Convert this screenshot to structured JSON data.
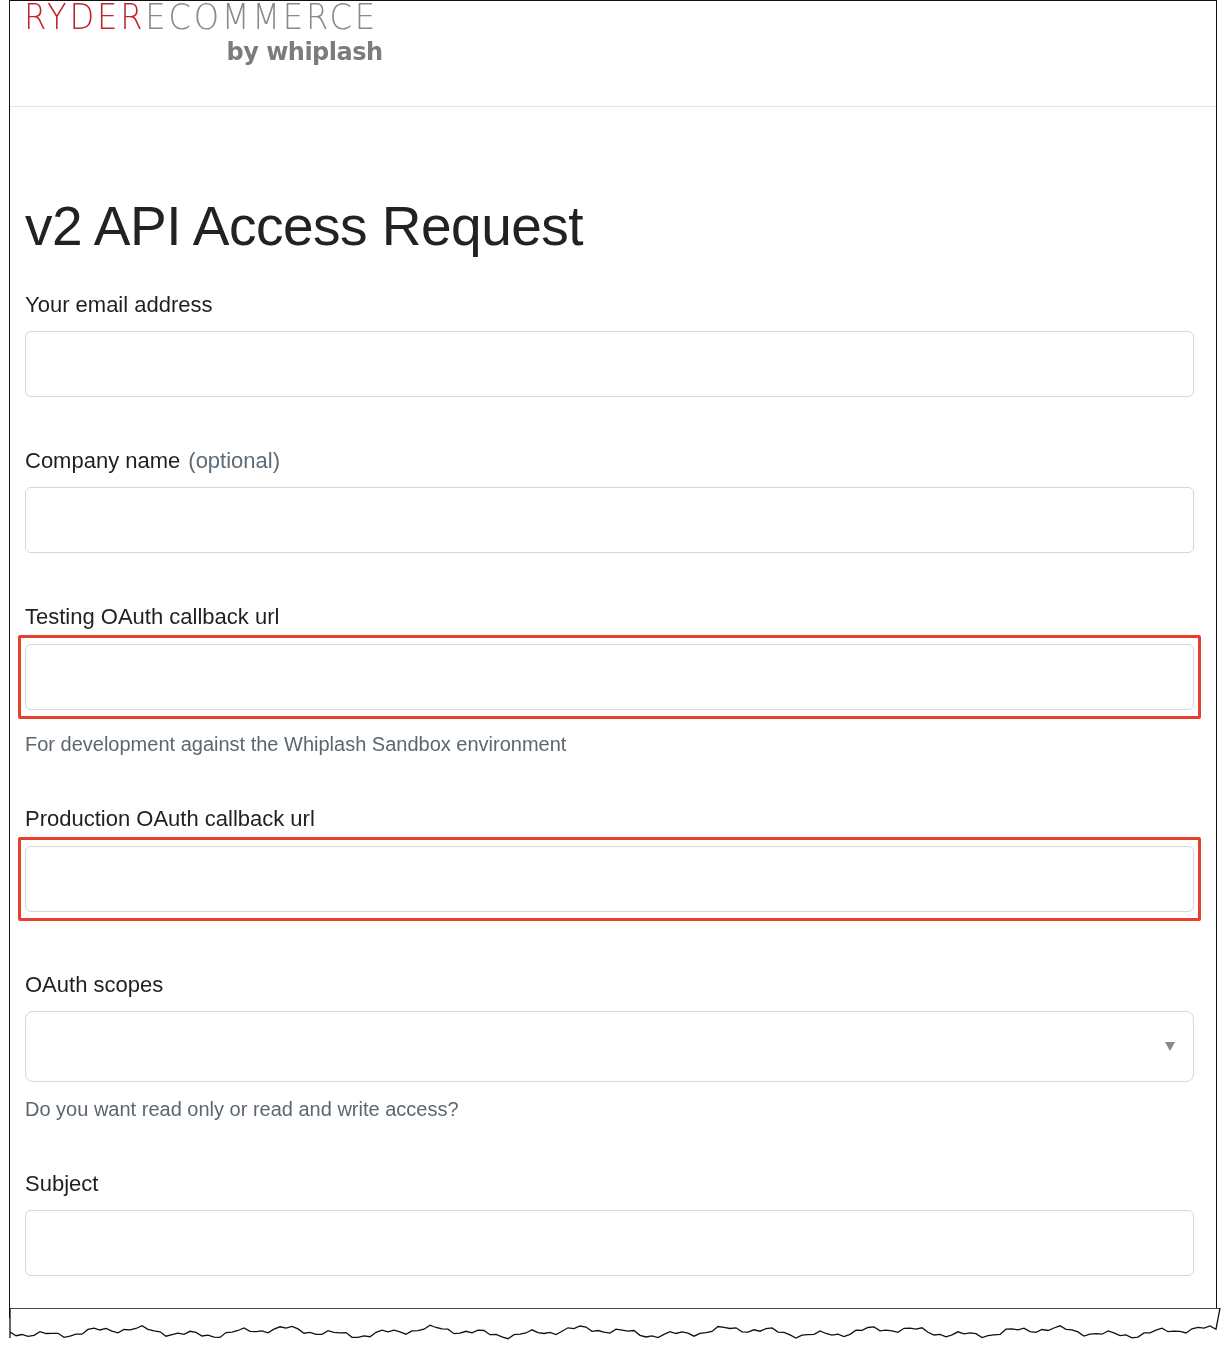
{
  "logo": {
    "brand_first": "RYDER",
    "brand_second": "ECOMMERCE",
    "tagline": "by whiplash"
  },
  "title": "v2 API Access Request",
  "fields": [
    {
      "kind": "text",
      "label": "Your email address",
      "highlighted": false
    },
    {
      "kind": "text",
      "label": "Company name",
      "optional": "(optional)",
      "highlighted": false
    },
    {
      "kind": "text",
      "label": "Testing OAuth callback url",
      "highlighted": true,
      "hint": "For development against the Whiplash Sandbox environment"
    },
    {
      "kind": "text",
      "label": "Production OAuth callback url",
      "highlighted": true
    },
    {
      "kind": "select",
      "label": "OAuth scopes",
      "highlighted": false,
      "hint": "Do you want read only or read and write access?"
    },
    {
      "kind": "text",
      "label": "Subject",
      "highlighted": false
    }
  ]
}
